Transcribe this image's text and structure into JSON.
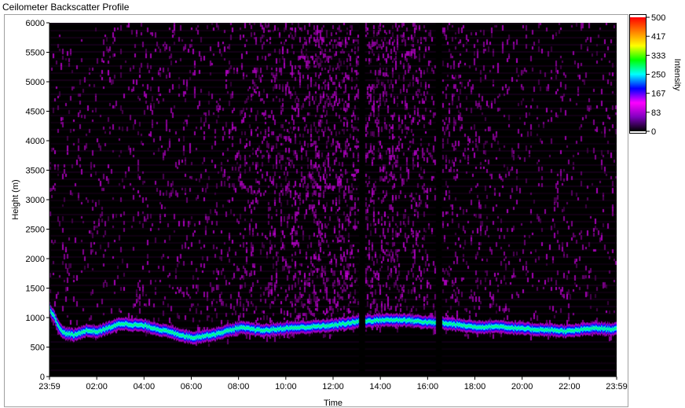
{
  "window": {
    "title": "Ceilometer Backscatter Profile"
  },
  "chart_data": {
    "type": "heatmap",
    "title": "Ceilometer Backscatter Profile",
    "xlabel": "Time",
    "ylabel": "Height (m)",
    "x_ticks": [
      "23:59",
      "02:00",
      "04:00",
      "06:00",
      "08:00",
      "10:00",
      "12:00",
      "14:00",
      "16:00",
      "18:00",
      "20:00",
      "22:00",
      "23:59"
    ],
    "y_ticks": [
      "0",
      "500",
      "1000",
      "1500",
      "2000",
      "2500",
      "3000",
      "3500",
      "4000",
      "4500",
      "5000",
      "5500",
      "6000"
    ],
    "ylim": [
      0,
      6000
    ],
    "colorbar": {
      "label": "Intensity",
      "ticks": [
        "500",
        "417",
        "333",
        "250",
        "167",
        "83",
        "0"
      ],
      "range": [
        0,
        500
      ],
      "colors": [
        "#000000",
        "#8000c0",
        "#ff00ff",
        "#0000ff",
        "#00ffff",
        "#00ff00",
        "#ffff00",
        "#ff8000",
        "#ff0000"
      ]
    },
    "layer_height_m": [
      {
        "t": "23:59",
        "h": 1150
      },
      {
        "t": "00:30",
        "h": 750
      },
      {
        "t": "01:00",
        "h": 700
      },
      {
        "t": "01:30",
        "h": 780
      },
      {
        "t": "02:00",
        "h": 760
      },
      {
        "t": "03:00",
        "h": 900
      },
      {
        "t": "04:00",
        "h": 860
      },
      {
        "t": "05:00",
        "h": 760
      },
      {
        "t": "06:00",
        "h": 660
      },
      {
        "t": "07:00",
        "h": 720
      },
      {
        "t": "08:00",
        "h": 830
      },
      {
        "t": "09:00",
        "h": 780
      },
      {
        "t": "10:00",
        "h": 820
      },
      {
        "t": "11:00",
        "h": 840
      },
      {
        "t": "12:00",
        "h": 870
      },
      {
        "t": "13:00",
        "h": 930
      },
      {
        "t": "14:00",
        "h": 960
      },
      {
        "t": "15:00",
        "h": 960
      },
      {
        "t": "16:00",
        "h": 920
      },
      {
        "t": "17:00",
        "h": 890
      },
      {
        "t": "18:00",
        "h": 840
      },
      {
        "t": "19:00",
        "h": 850
      },
      {
        "t": "20:00",
        "h": 810
      },
      {
        "t": "21:00",
        "h": 790
      },
      {
        "t": "22:00",
        "h": 770
      },
      {
        "t": "23:00",
        "h": 820
      },
      {
        "t": "23:59",
        "h": 800
      }
    ],
    "data_gaps": [
      {
        "from": "13:05",
        "to": "13:20"
      },
      {
        "from": "16:20",
        "to": "16:35"
      }
    ],
    "grid": false
  }
}
